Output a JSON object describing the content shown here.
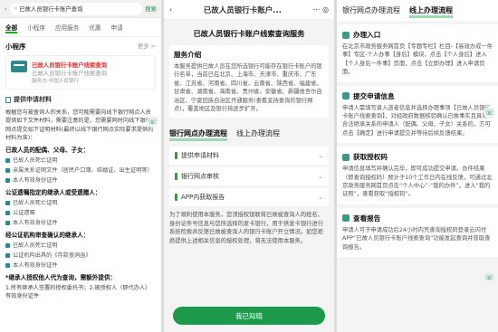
{
  "p1": {
    "search_value": "已故人员银行卡账户查询",
    "search_btn": "搜索",
    "tabs": [
      "全部",
      "小程序",
      "应用服务",
      "优惠",
      "申请"
    ],
    "mini_title": "小程序",
    "more": "更多 >",
    "card_title": "已故人员银行卡账户线索查询",
    "card_sub": "已故人员银行卡账户线索查询",
    "card_foot": "服务方:中国人民银行",
    "sec1": "提供申请材料",
    "intro": "根据您与被查询人的关系，您可能需要向线下银行网点人员提供如下文件材料，需要注意的是，您需要同时向线下银行网点提交如下证明材料(最终以线下银行网点实际要求提供的材料为准)：",
    "spouse_head": "已故人员的配偶、父母、子女：",
    "r1": "已故人员死亡证明",
    "r2": "亲属关系证明文件（居民户口簿、结婚证、出生证明等）",
    "r3": "本人有效身份证件",
    "notary_head": "公证遗嘱指定的继承人或受遗赠人：",
    "r4": "已故人员死亡证明",
    "r5": "公证遗嘱",
    "r6": "本人有效身份证件",
    "court_head": "经公证机构审查确认的继承人：",
    "r7": "已故人员死亡证明",
    "r8": "公证机构出具的《存款查询函》",
    "r9": "本人有效身份证件",
    "foot_head": "*继承人授权他人代为查询，需额外提供：",
    "foot": "1.所有继承人签署的授权委托书；2.被授权人（即代办人）有效身份证件"
  },
  "p2": {
    "title": "已故人员银行卡账户...",
    "heading": "已故人员银行卡账户线索查询服务",
    "intro_title": "服务介绍",
    "intro": "本服务提供已故人员在您所选银行可能存在银行卡账户的银行名单，当前已在北京、上海市、天津市、重庆市、广东省、江苏省、河南省、四川省、云南省、陕西省、福建省、甘肃省、湖南省、海南省、贵州省、安徽省、新疆维吾尔自治区、宁夏回族自治区开通服务(查看支持查询的银行网点)，覆盖地区及银行将逐步扩开。",
    "tab_on": "银行网点办理流程",
    "tab_off": "线上办理流程",
    "i1": "提供申请材料",
    "i2": "银行网点审核",
    "i3": "APP内获取报告",
    "notice": "为了顺利使用本服务，您须授权银联将已故被查询人的姓名、身份证件号信息与您所选择的发卡银行，用于供发卡银行进行系统检索并反馈已故被查询人的银行卡账户开立情况。如您拒绝提供上述相关信息的授权处理，将无法使用本服务。",
    "ok": "我已知晓"
  },
  "p3": {
    "tab_off": "银行网点办理流程",
    "tab_on": "线上办理流程",
    "s1": "办理入口",
    "s1_txt": "在北京市政务服务网首页【专题专栏】栏目-【高效办成一件事】专区-个人办事【身后】模块，点击【个人身后】进入【个人身后一件事】页面，点击【立即办理】进入申请页面。",
    "s2": "提交申请信息",
    "s2_txt": "申请人需填写录入逝者信息并选择办理事项【已故人员银行卡账户线索查询】，对经政府数据核验确认已故事实且具有合法继承关系的申请人（配偶、父母、子女）关系的，方可点击【确定】进行申请提交并等待后续反馈结果。",
    "s3": "获取授权码",
    "s3_txt": "申请信息填写并确认完毕，即可成功提交申请。办件结果（即查询授权码）预计于10个工作日内在线反馈，可通过北京政务服务网首页点击“个人中心”-“我的办件”，进入“我的证照”，查看获取“授权码”。",
    "s4": "查看报告",
    "s4_txt": "申请人可于申请成功后24小时内凭查询授权码登录云闪付APP“已故人员银行卡账户线索查询”功能发起查询并获取查询报告。"
  }
}
